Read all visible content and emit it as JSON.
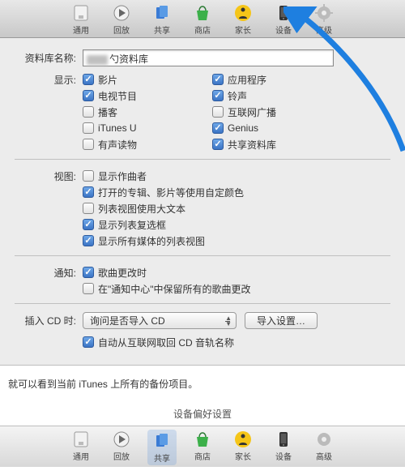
{
  "toolbar": {
    "items": [
      {
        "label": "通用",
        "icon": "general-icon"
      },
      {
        "label": "回放",
        "icon": "playback-icon"
      },
      {
        "label": "共享",
        "icon": "sharing-icon"
      },
      {
        "label": "商店",
        "icon": "store-icon"
      },
      {
        "label": "家长",
        "icon": "parental-icon"
      },
      {
        "label": "设备",
        "icon": "devices-icon"
      },
      {
        "label": "高级",
        "icon": "advanced-icon"
      }
    ]
  },
  "library": {
    "name_label": "资料库名称:",
    "name_suffix": "勺资料库"
  },
  "display": {
    "label": "显示:",
    "items": [
      {
        "label": "影片",
        "checked": true
      },
      {
        "label": "应用程序",
        "checked": true
      },
      {
        "label": "电视节目",
        "checked": true
      },
      {
        "label": "铃声",
        "checked": true
      },
      {
        "label": "播客",
        "checked": false
      },
      {
        "label": "互联网广播",
        "checked": false
      },
      {
        "label": "iTunes U",
        "checked": false
      },
      {
        "label": "Genius",
        "checked": true
      },
      {
        "label": "有声读物",
        "checked": false
      },
      {
        "label": "共享资料库",
        "checked": true
      }
    ]
  },
  "view": {
    "label": "视图:",
    "items": [
      {
        "label": "显示作曲者",
        "checked": false
      },
      {
        "label": "打开的专辑、影片等使用自定颜色",
        "checked": true
      },
      {
        "label": "列表视图使用大文本",
        "checked": false
      },
      {
        "label": "显示列表复选框",
        "checked": true
      },
      {
        "label": "显示所有媒体的列表视图",
        "checked": true
      }
    ]
  },
  "notify": {
    "label": "通知:",
    "items": [
      {
        "label": "歌曲更改时",
        "checked": true
      },
      {
        "label": "在\"通知中心\"中保留所有的歌曲更改",
        "checked": false
      }
    ]
  },
  "insert": {
    "label": "插入 CD 时:",
    "select": "询问是否导入 CD",
    "button": "导入设置…",
    "auto": {
      "label": "自动从互联网取回 CD 音轨名称",
      "checked": true
    }
  },
  "caption": "就可以看到当前 iTunes 上所有的备份项目。",
  "footer_title": "设备偏好设置"
}
